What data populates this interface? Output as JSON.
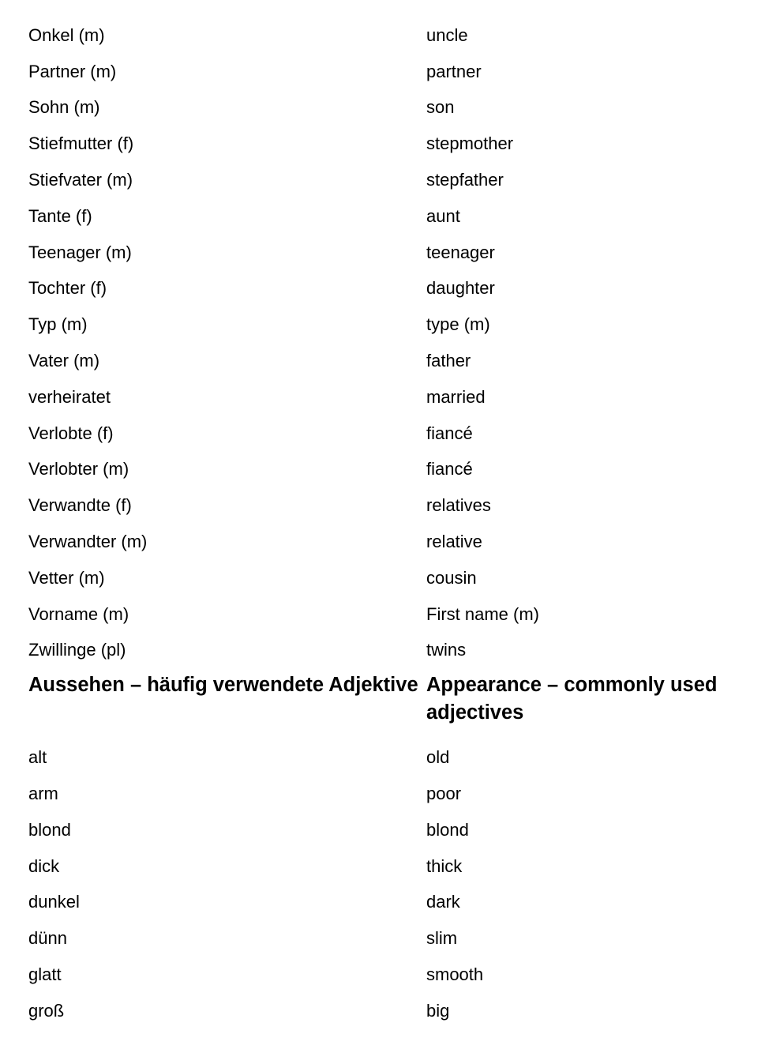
{
  "rows_top": [
    {
      "de": "Onkel (m)",
      "en": "uncle"
    },
    {
      "de": "Partner (m)",
      "en": "partner"
    },
    {
      "de": "Sohn (m)",
      "en": "son"
    },
    {
      "de": "Stiefmutter (f)",
      "en": "stepmother"
    },
    {
      "de": "Stiefvater (m)",
      "en": "stepfather"
    },
    {
      "de": "Tante (f)",
      "en": "aunt"
    },
    {
      "de": "Teenager (m)",
      "en": "teenager"
    },
    {
      "de": "Tochter (f)",
      "en": "daughter"
    },
    {
      "de": "Typ (m)",
      "en": "type (m)"
    },
    {
      "de": "Vater (m)",
      "en": "father"
    },
    {
      "de": "verheiratet",
      "en": "married"
    },
    {
      "de": "Verlobte (f)",
      "en": "fiancé"
    },
    {
      "de": "Verlobter (m)",
      "en": "fiancé"
    },
    {
      "de": "Verwandte (f)",
      "en": "relatives"
    },
    {
      "de": "Verwandter (m)",
      "en": "relative"
    },
    {
      "de": "Vetter (m)",
      "en": "cousin"
    },
    {
      "de": "Vorname (m)",
      "en": "First name (m)"
    },
    {
      "de": "Zwillinge (pl)",
      "en": "twins"
    }
  ],
  "section": {
    "de": "Aussehen – häufig verwendete Adjektive",
    "en": "Appearance – commonly used adjectives"
  },
  "rows_bottom": [
    {
      "de": "alt",
      "en": "old"
    },
    {
      "de": "arm",
      "en": "poor"
    },
    {
      "de": "blond",
      "en": "blond"
    },
    {
      "de": "dick",
      "en": "thick"
    },
    {
      "de": "dunkel",
      "en": "dark"
    },
    {
      "de": "dünn",
      "en": "slim"
    },
    {
      "de": "glatt",
      "en": "smooth"
    },
    {
      "de": "groß",
      "en": "big"
    }
  ]
}
